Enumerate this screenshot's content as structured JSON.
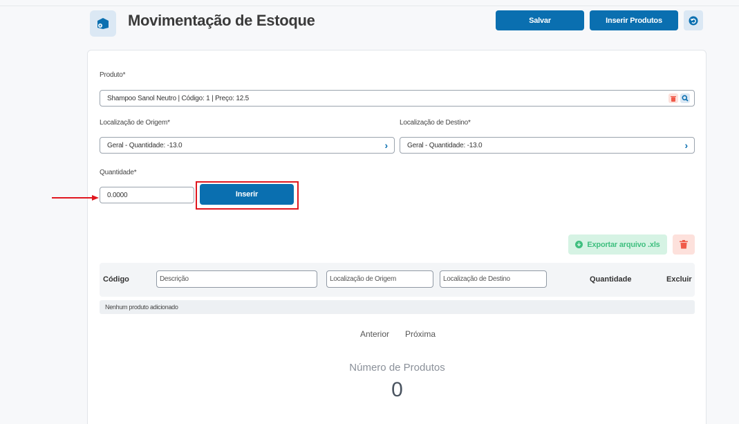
{
  "header": {
    "title": "Movimentação de Estoque",
    "save_label": "Salvar",
    "insert_products_label": "Inserir Produtos"
  },
  "form": {
    "product_label": "Produto*",
    "product_value": "Shampoo Sanol Neutro | Código: 1 | Preço: 12.5",
    "origin_label": "Localização de Origem*",
    "origin_value": "Geral - Quantidade: -13.0",
    "destination_label": "Localização de Destino*",
    "destination_value": "Geral - Quantidade: -13.0",
    "quantity_label": "Quantidade*",
    "quantity_value": "0.0000",
    "insert_label": "Inserir"
  },
  "actions": {
    "export_label": "Exportar arquivo .xls"
  },
  "table": {
    "col_code": "Código",
    "col_description_placeholder": "Descrição",
    "col_origin_placeholder": "Localização de Origem",
    "col_destination_placeholder": "Localização de Destino",
    "col_quantity": "Quantidade",
    "col_delete": "Excluir",
    "empty_text": "Nenhum produto adicionado"
  },
  "pagination": {
    "previous": "Anterior",
    "next": "Próxima"
  },
  "summary": {
    "label": "Número de Produtos",
    "value": "0"
  },
  "colors": {
    "primary": "#0a6fb0",
    "highlight": "#e0161e",
    "export_bg": "#d6f3e4",
    "danger_bg": "#fde1dc"
  },
  "icons": [
    "box-icon",
    "undo-icon",
    "trash-icon",
    "search-icon",
    "chevron-right-icon",
    "download-icon",
    "arrow-right-icon"
  ]
}
